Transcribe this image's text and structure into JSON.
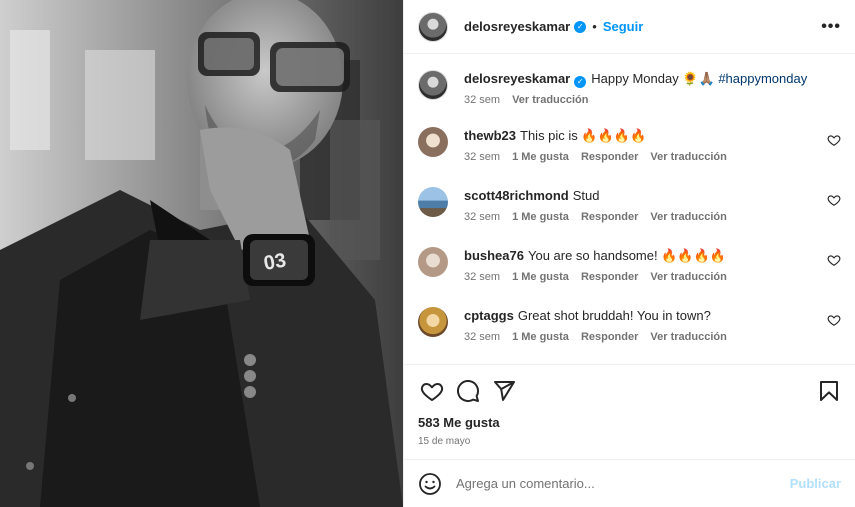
{
  "post": {
    "author": "delosreyeskamar",
    "dot": "•",
    "follow_label": "Seguir",
    "more_label": "•••",
    "caption": {
      "username": "delosreyeskamar",
      "text": "Happy Monday 🌻🙏🏽",
      "hashtag": "#happymonday",
      "age": "32 sem",
      "translate": "Ver traducción"
    }
  },
  "comments": [
    {
      "username": "thewb23",
      "text": "This pic is 🔥🔥🔥🔥",
      "age": "32 sem",
      "likes": "1 Me gusta",
      "reply": "Responder",
      "translate": "Ver traducción",
      "avatar_color": "#8a6f5e"
    },
    {
      "username": "scott48richmond",
      "text": "Stud",
      "age": "32 sem",
      "likes": "1 Me gusta",
      "reply": "Responder",
      "translate": "Ver traducción",
      "avatar_color": "#4e7ea8"
    },
    {
      "username": "bushea76",
      "text": "You are so handsome! 🔥🔥🔥🔥",
      "age": "32 sem",
      "likes": "1 Me gusta",
      "reply": "Responder",
      "translate": "Ver traducción",
      "avatar_color": "#b49a86"
    },
    {
      "username": "cptaggs",
      "text": "Great shot bruddah! You in town?",
      "age": "32 sem",
      "likes": "1 Me gusta",
      "reply": "Responder",
      "translate": "Ver traducción",
      "avatar_color": "#c7963c"
    }
  ],
  "stats": {
    "likes": "583 Me gusta",
    "date": "15 de mayo"
  },
  "composer": {
    "placeholder": "Agrega un comentario...",
    "publish_label": "Publicar"
  },
  "icons": {
    "like": "heart-icon",
    "comment": "comment-icon",
    "share": "share-icon",
    "save": "bookmark-icon",
    "emoji": "emoji-icon",
    "verified": "verified-badge-icon",
    "more": "more-options-icon"
  },
  "colors": {
    "accent": "#0095f6",
    "publish_disabled": "#b2dffc",
    "muted": "#737373",
    "hashtag": "#00376b"
  }
}
